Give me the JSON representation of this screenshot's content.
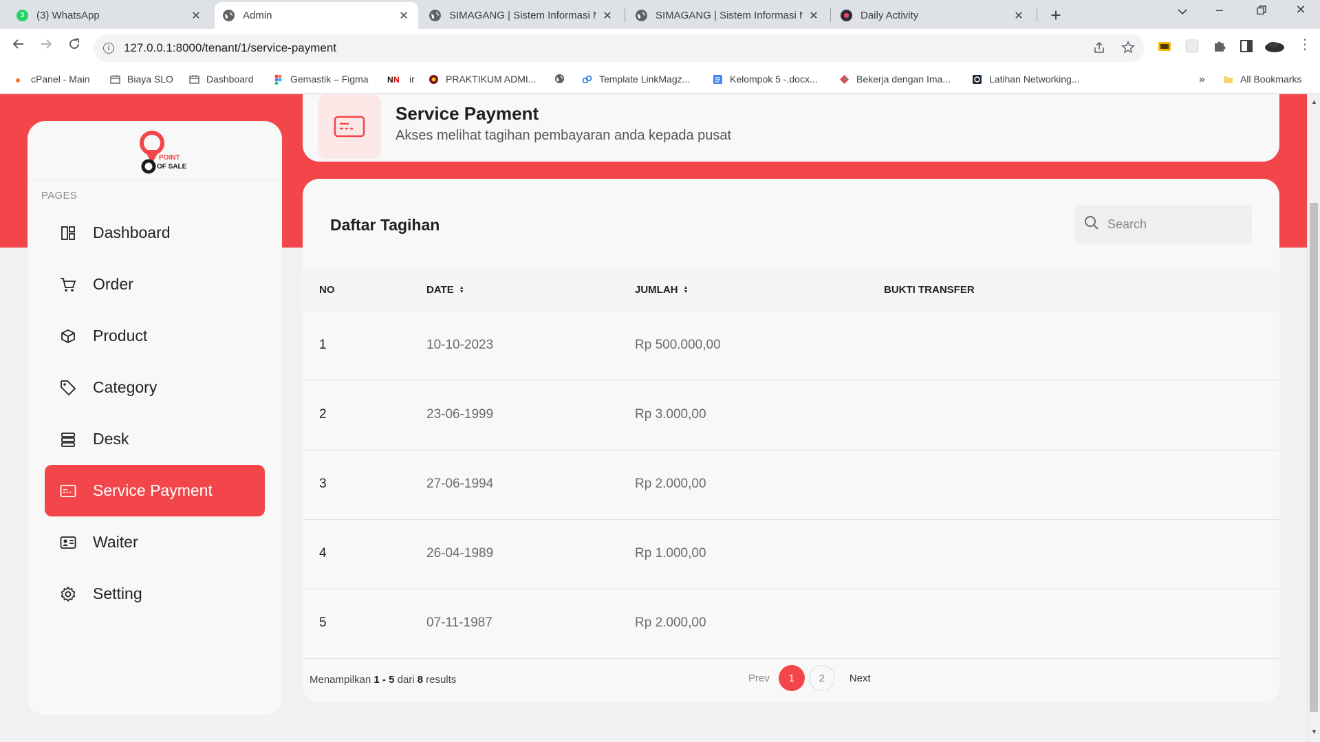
{
  "browser": {
    "tabs": [
      {
        "title": "(3) WhatsApp",
        "icon": "whatsapp-icon",
        "badge": "3",
        "color": "#25d366",
        "active": false
      },
      {
        "title": "Admin",
        "icon": "globe-icon",
        "active": true
      },
      {
        "title": "SIMAGANG | Sistem Informasi M",
        "icon": "globe-icon",
        "active": false
      },
      {
        "title": "SIMAGANG | Sistem Informasi M",
        "icon": "globe-icon",
        "active": false
      },
      {
        "title": "Daily Activity",
        "icon": "daily-activity-icon",
        "active": false
      }
    ],
    "url": "127.0.0.1:8000/tenant/1/service-payment",
    "bookmarks": [
      {
        "label": "cPanel - Main",
        "icon": "cpanel-icon"
      },
      {
        "label": "Biaya SLO",
        "icon": "bookmark-page-icon"
      },
      {
        "label": "Dashboard",
        "icon": "bookmark-page-icon"
      },
      {
        "label": "Gemastik – Figma",
        "icon": "figma-icon"
      },
      {
        "label": "ir",
        "icon": "nn-icon"
      },
      {
        "label": "PRAKTIKUM ADMI...",
        "icon": "praktikum-icon"
      },
      {
        "label": "",
        "icon": "globe-icon"
      },
      {
        "label": "Template LinkMagz...",
        "icon": "link-icon"
      },
      {
        "label": "Kelompok 5 -.docx...",
        "icon": "docs-icon"
      },
      {
        "label": "Bekerja dengan Ima...",
        "icon": "bekerja-icon"
      },
      {
        "label": "Latihan Networking...",
        "icon": "latihan-icon"
      }
    ],
    "bookmarks_overflow": "»",
    "all_bookmarks": "All Bookmarks"
  },
  "sidebar": {
    "logo_text_1": "POINT",
    "logo_text_2": "OF SALE",
    "section_label": "PAGES",
    "items": [
      {
        "label": "Dashboard",
        "icon": "dashboard-icon",
        "active": false
      },
      {
        "label": "Order",
        "icon": "cart-icon",
        "active": false
      },
      {
        "label": "Product",
        "icon": "box-icon",
        "active": false
      },
      {
        "label": "Category",
        "icon": "tag-icon",
        "active": false
      },
      {
        "label": "Desk",
        "icon": "desk-icon",
        "active": false
      },
      {
        "label": "Service Payment",
        "icon": "payment-card-icon",
        "active": true
      },
      {
        "label": "Waiter",
        "icon": "id-card-icon",
        "active": false
      },
      {
        "label": "Setting",
        "icon": "gear-icon",
        "active": false
      }
    ]
  },
  "header": {
    "title": "Service Payment",
    "subtitle": "Akses melihat tagihan pembayaran anda kepada pusat"
  },
  "table": {
    "title": "Daftar Tagihan",
    "search_placeholder": "Search",
    "columns": [
      "NO",
      "DATE",
      "JUMLAH",
      "BUKTI TRANSFER"
    ],
    "rows": [
      {
        "no": "1",
        "date": "10-10-2023",
        "amount": "Rp 500.000,00",
        "proof": ""
      },
      {
        "no": "2",
        "date": "23-06-1999",
        "amount": "Rp 3.000,00",
        "proof": ""
      },
      {
        "no": "3",
        "date": "27-06-1994",
        "amount": "Rp 2.000,00",
        "proof": ""
      },
      {
        "no": "4",
        "date": "26-04-1989",
        "amount": "Rp 1.000,00",
        "proof": ""
      },
      {
        "no": "5",
        "date": "07-11-1987",
        "amount": "Rp 2.000,00",
        "proof": ""
      }
    ],
    "footer": {
      "prefix": "Menampilkan",
      "from": "1",
      "dash": "-",
      "to": "5",
      "of_word": "dari",
      "total": "8",
      "suffix": "results"
    },
    "pagination": {
      "prev": "Prev",
      "pages": [
        "1",
        "2"
      ],
      "current": "1",
      "next": "Next"
    }
  },
  "colors": {
    "accent": "#f2464a",
    "accent_light": "#fde8e8",
    "card": "#f8f8f8",
    "page_bg": "#f1f1f1"
  }
}
